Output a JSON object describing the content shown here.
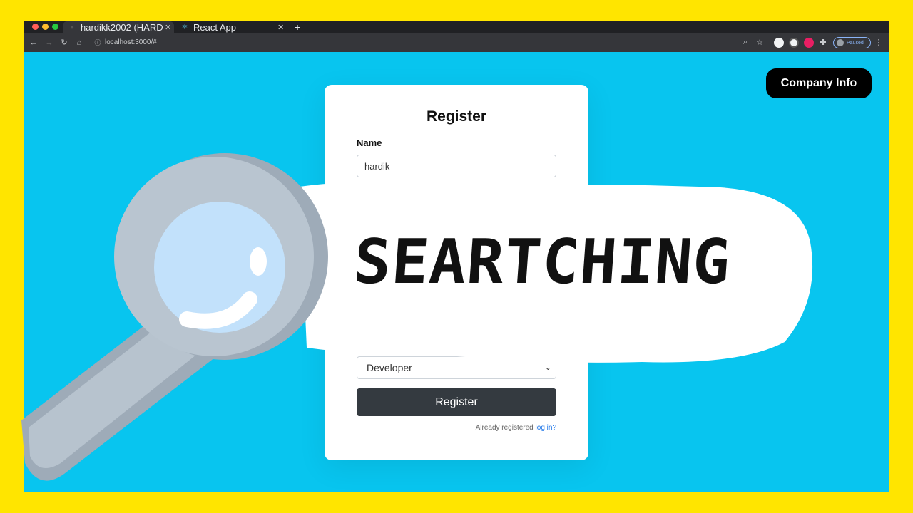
{
  "browser": {
    "tabs": [
      {
        "title": "hardikk2002 (HARD",
        "icon": "github-icon"
      },
      {
        "title": "React App",
        "icon": "react-icon"
      }
    ],
    "url": "localhost:3000/#",
    "profile_status": "Paused"
  },
  "page": {
    "company_button": "Company Info",
    "form": {
      "title": "Register",
      "name_label": "Name",
      "name_value": "hardik",
      "role_value": "Developer",
      "submit_label": "Register",
      "already_text": "Already registered",
      "login_link": "log in?"
    }
  },
  "overlay": {
    "text": "SEARTCHING",
    "icon": "magnifying-glass-icon"
  },
  "colors": {
    "frame": "#FFE500",
    "page_bg": "#08C5EF",
    "button_dark": "#343a40",
    "company_button": "#000000"
  }
}
